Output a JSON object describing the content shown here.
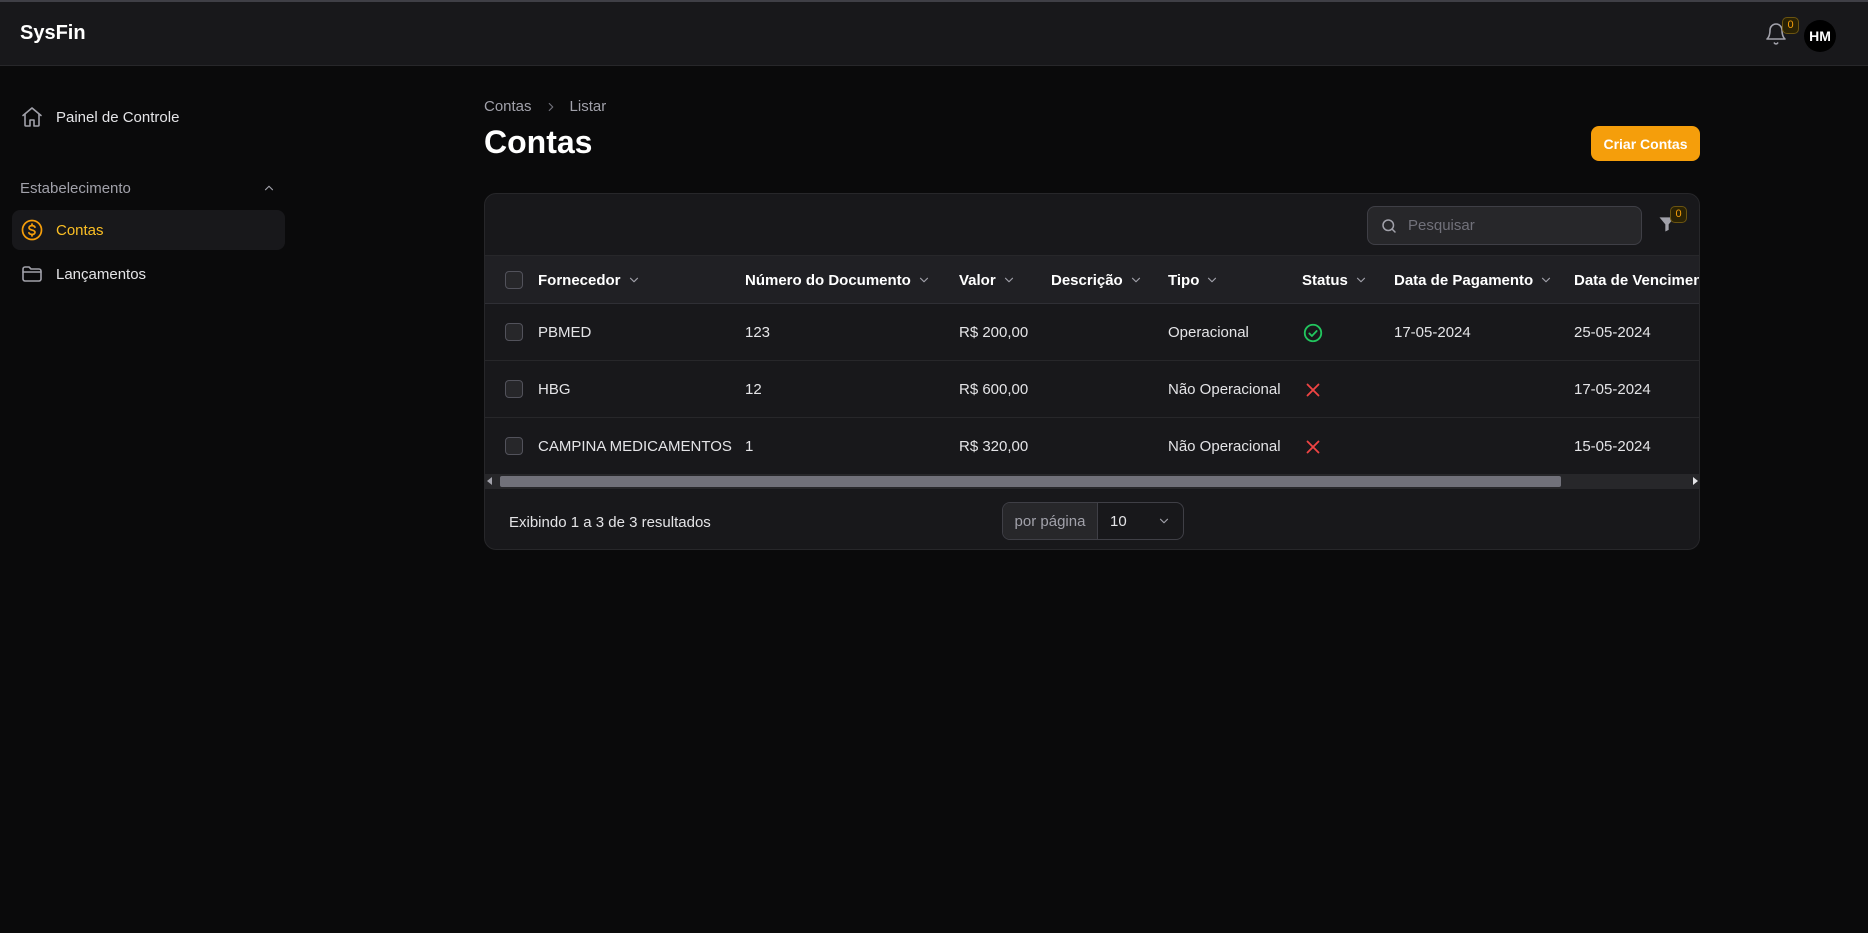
{
  "app": {
    "brand": "SysFin"
  },
  "header": {
    "notifications_count": "0",
    "avatar_initials": "HM"
  },
  "sidebar": {
    "items": [
      {
        "label": "Painel de Controle",
        "icon": "home-icon"
      },
      {
        "label": "Contas",
        "icon": "dollar-circle-icon",
        "active": true
      },
      {
        "label": "Lançamentos",
        "icon": "folder-icon"
      }
    ],
    "group_label": "Estabelecimento"
  },
  "breadcrumb": {
    "root": "Contas",
    "current": "Listar"
  },
  "page": {
    "title": "Contas",
    "create_button": "Criar Contas"
  },
  "search": {
    "placeholder": "Pesquisar"
  },
  "filter": {
    "count": "0"
  },
  "table": {
    "columns": [
      "Fornecedor",
      "Número do Documento",
      "Valor",
      "Descrição",
      "Tipo",
      "Status",
      "Data de Pagamento",
      "Data de Venciment"
    ],
    "rows": [
      {
        "fornecedor": "PBMED",
        "documento": "123",
        "valor": "R$ 200,00",
        "descricao": "",
        "tipo": "Operacional",
        "status": "paid",
        "pagamento": "17-05-2024",
        "vencimento": "25-05-2024"
      },
      {
        "fornecedor": "HBG",
        "documento": "12",
        "valor": "R$ 600,00",
        "descricao": "",
        "tipo": "Não Operacional",
        "status": "unpaid",
        "pagamento": "",
        "vencimento": "17-05-2024"
      },
      {
        "fornecedor": "CAMPINA MEDICAMENTOS",
        "documento": "1",
        "valor": "R$ 320,00",
        "descricao": "",
        "tipo": "Não Operacional",
        "status": "unpaid",
        "pagamento": "",
        "vencimento": "15-05-2024"
      }
    ]
  },
  "pagination": {
    "summary": "Exibindo 1 a 3 de 3 resultados",
    "per_page_label": "por página",
    "per_page_value": "10"
  },
  "colors": {
    "accent": "#f59e0b",
    "success": "#22c55e",
    "danger": "#ef4444",
    "background": "#0a0a0b",
    "surface": "#18181b"
  }
}
